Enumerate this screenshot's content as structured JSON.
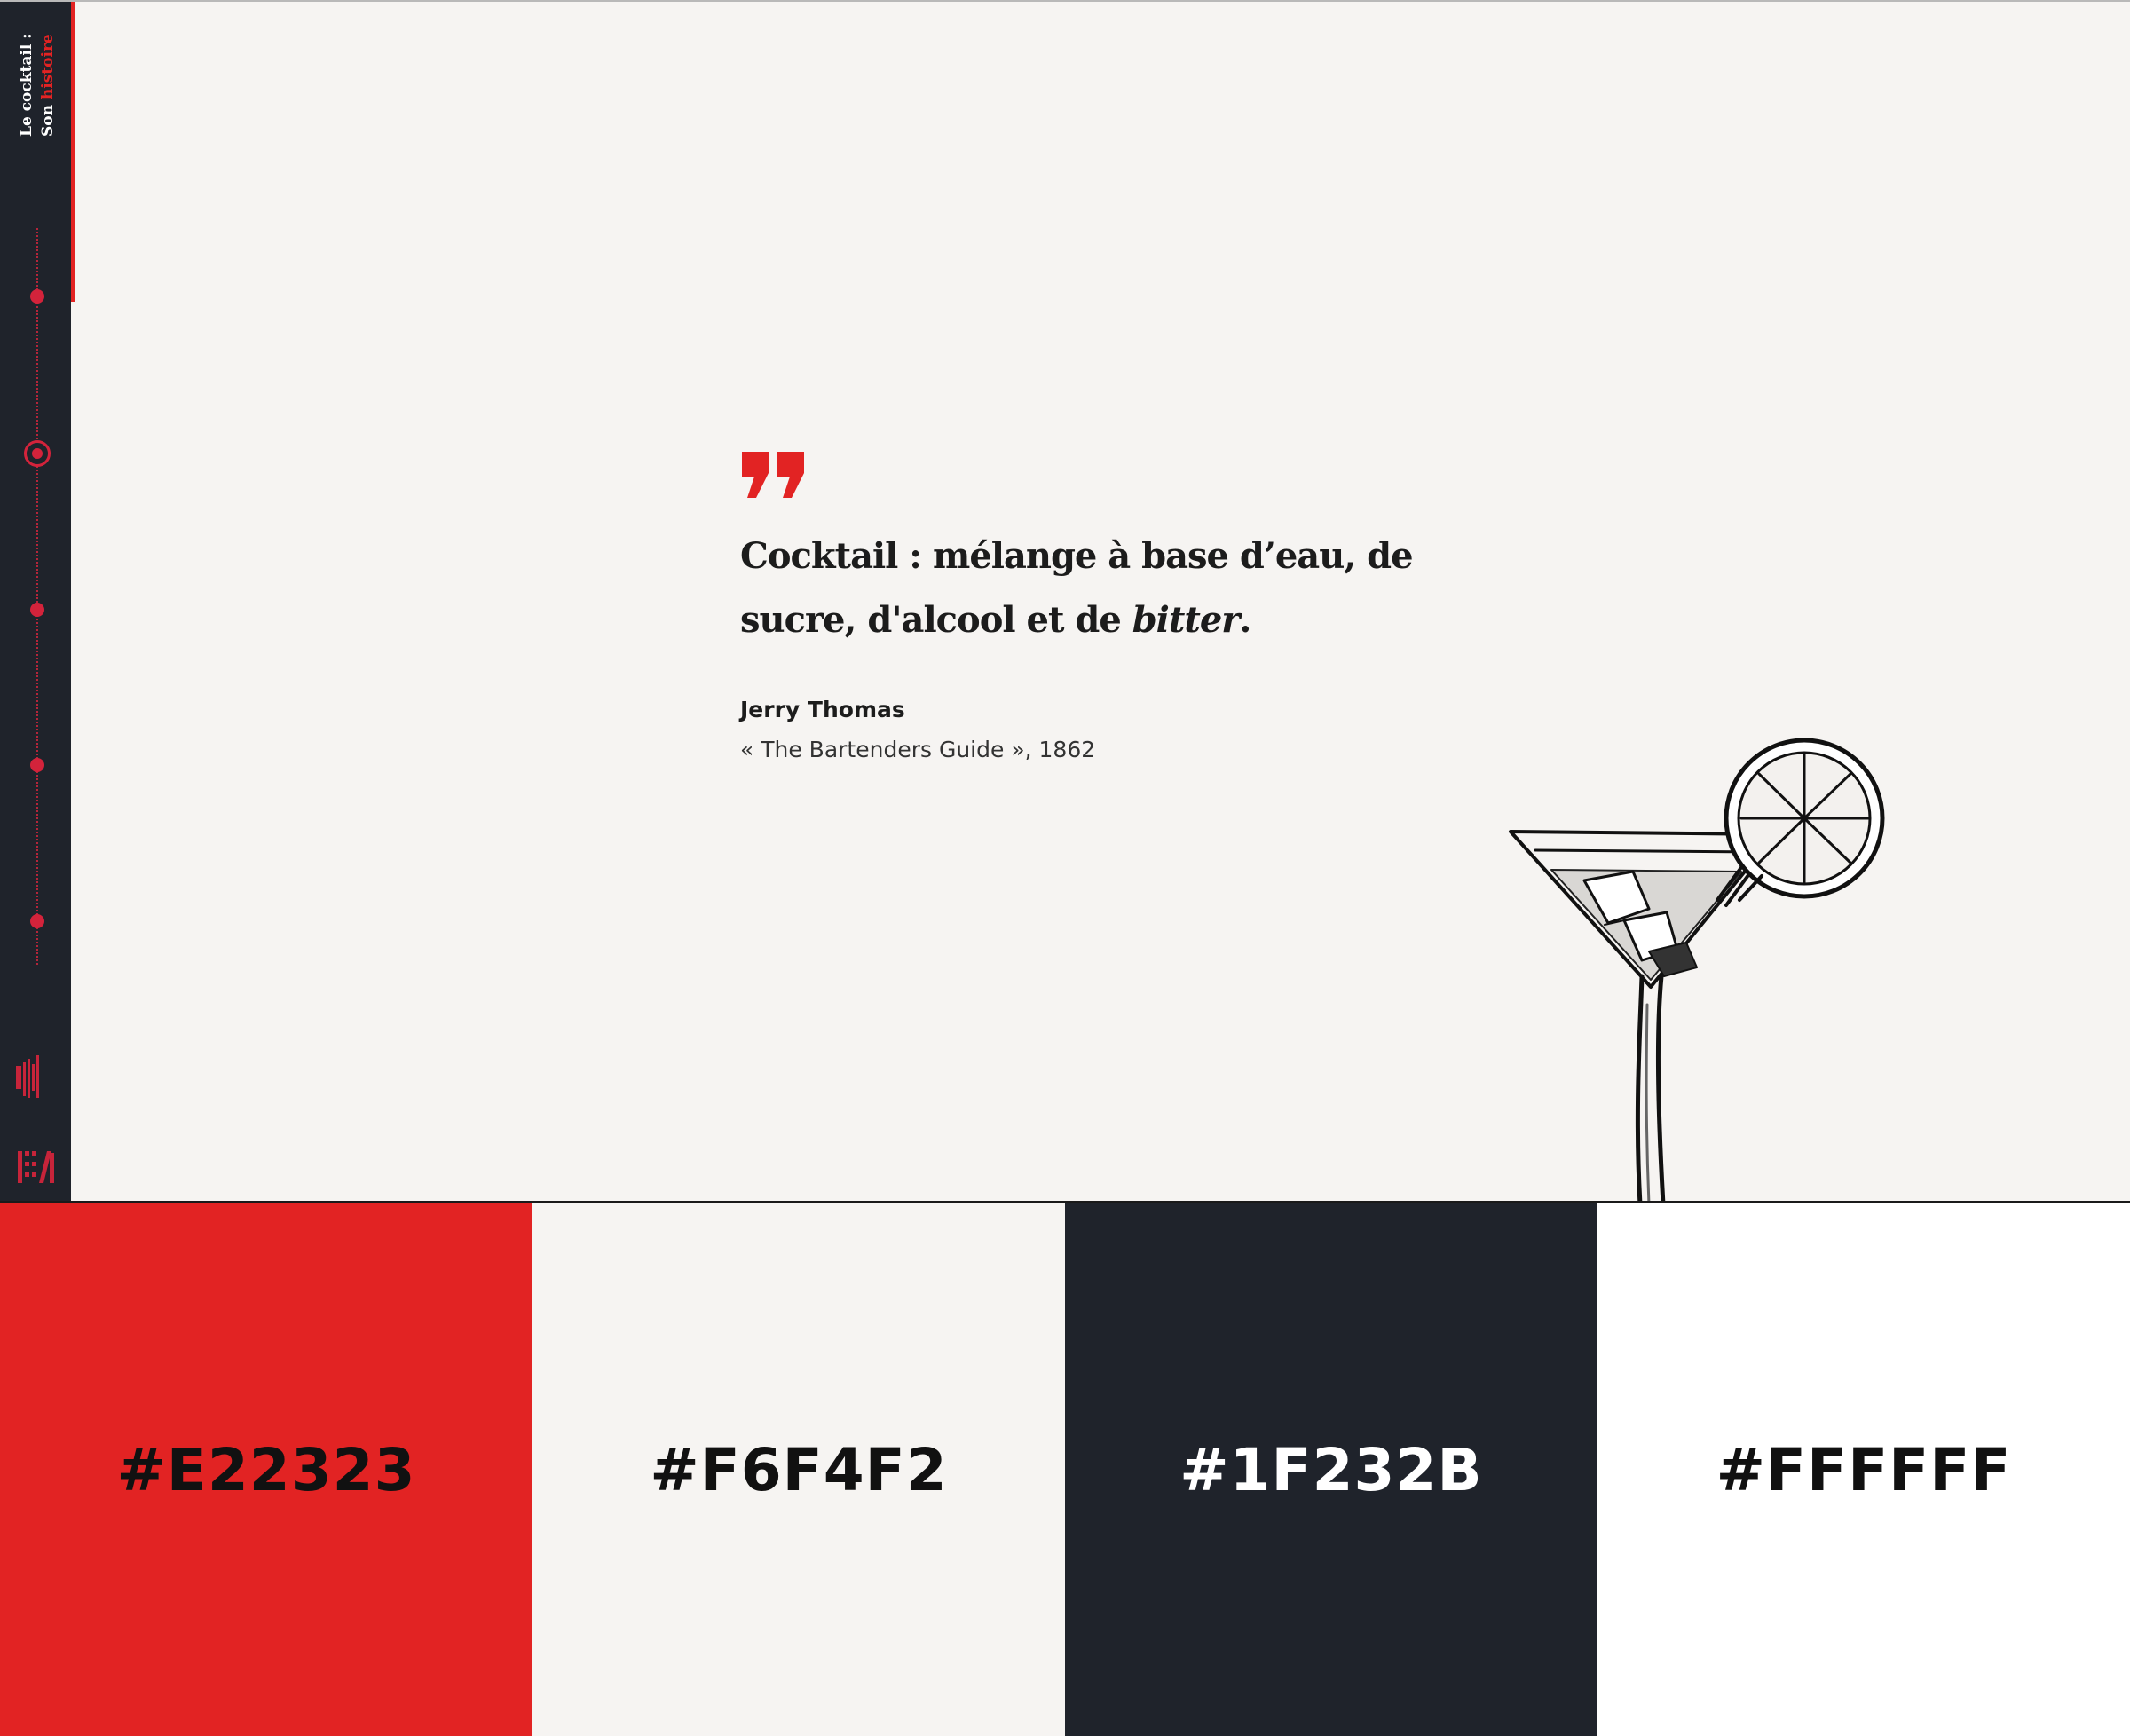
{
  "sidebar": {
    "title_line1": "Le cocktail :",
    "title_line2_prefix": "Son ",
    "title_line2_accent": "histoire",
    "timeline_steps": 5,
    "active_step": 2
  },
  "quote": {
    "text_line1": "Cocktail : mélange à base d’eau, de",
    "text_line2_prefix": "sucre, d'alcool et de ",
    "text_line2_italic": "bitter",
    "text_line2_suffix": ".",
    "author": "Jerry Thomas",
    "source": "« The Bartenders Guide », 1862"
  },
  "palette": [
    {
      "label": "#E22323",
      "color": "#E22323",
      "text_color": "#111111"
    },
    {
      "label": "#F6F4F2",
      "color": "#F6F4F2",
      "text_color": "#111111"
    },
    {
      "label": "#1F232B",
      "color": "#1F232B",
      "text_color": "#ffffff"
    },
    {
      "label": "#FFFFFF",
      "color": "#FFFFFF",
      "text_color": "#111111"
    }
  ],
  "colors": {
    "accent": "#E22323",
    "background": "#F6F4F2",
    "sidebar": "#1F232B"
  },
  "icons": {
    "quote": "quote-icon",
    "illustration": "cocktail-glass-icon",
    "logo": "brand-logo-icon"
  }
}
